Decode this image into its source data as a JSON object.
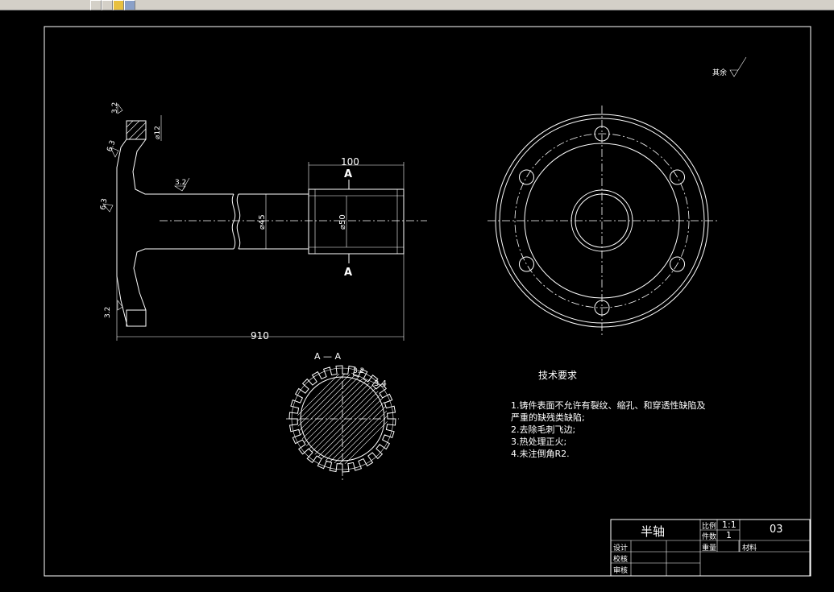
{
  "drawing": {
    "name": "半轴",
    "scale_label": "比例",
    "scale_value": "1:1",
    "qty_label": "件数",
    "qty_value": "1",
    "drawing_no": "03",
    "weight_label": "重量",
    "material_label": "材料",
    "designer_label": "设计",
    "checker_label": "校核",
    "reviewer_label": "审核"
  },
  "dimensions": {
    "overall_length": "910",
    "spline_length": "100",
    "shaft_dia": "⌀45",
    "spline_dia": "⌀50",
    "hole_dia": "⌀12",
    "section_mark_top": "A",
    "section_mark_bottom": "A",
    "section_title": "A — A",
    "rough_3_2_a": "3.2",
    "rough_3_2_b": "3.2",
    "rough_3_2_c": "3.2",
    "rough_3_2_d": "3.2",
    "rough_6_3_a": "6.3",
    "rough_6_3_b": "6.3",
    "rough_3_4": "3.4",
    "rough_rest": "其余"
  },
  "tech": {
    "title": "技术要求",
    "items": [
      "1.铸件表面不允许有裂纹、缩孔、和穿透性缺陷及",
      "严重的缺残类缺陷;",
      "2.去除毛刺飞边;",
      "3.热处理正火;",
      "4.未注倒角R2."
    ]
  }
}
